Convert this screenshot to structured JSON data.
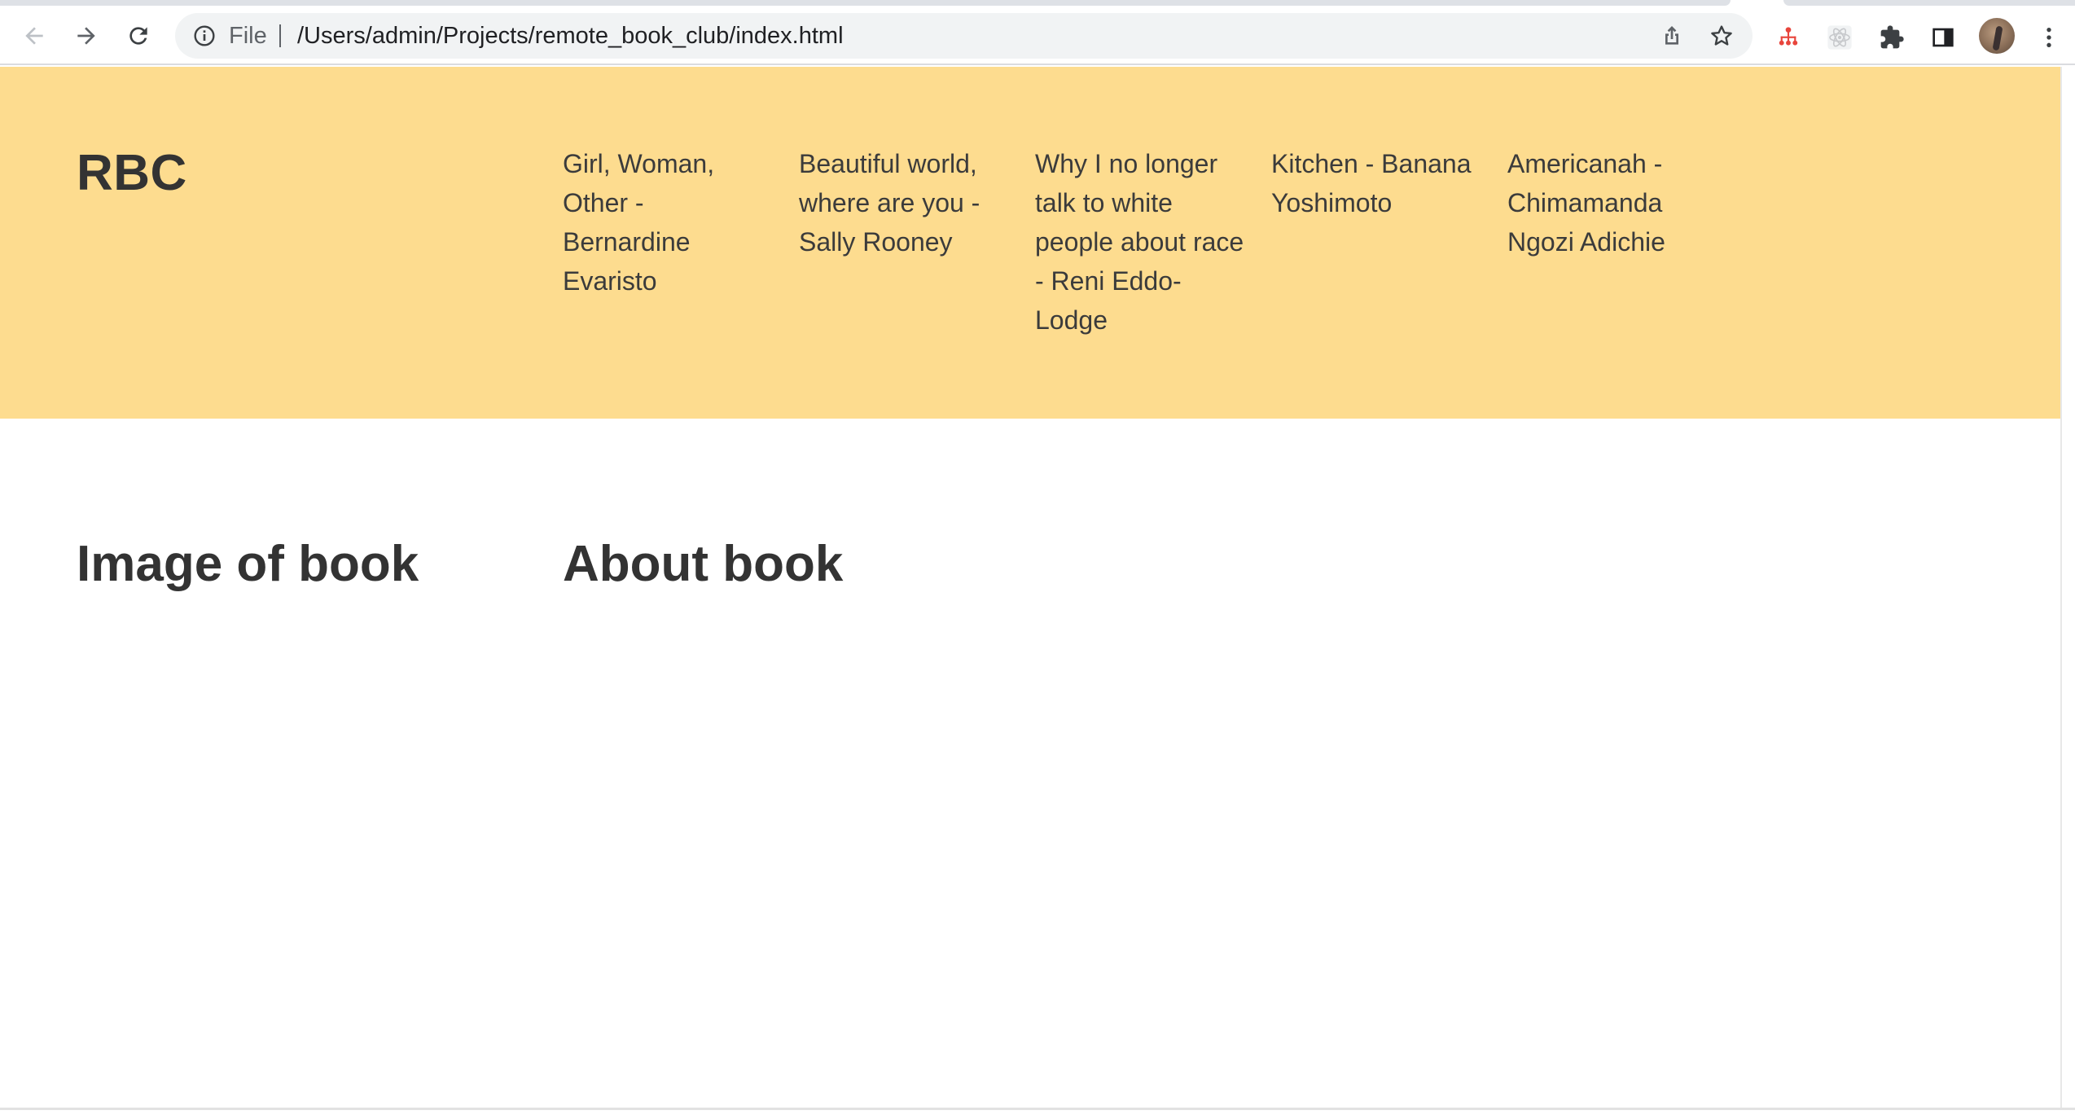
{
  "browser": {
    "scheme_label": "File",
    "url": "/Users/admin/Projects/remote_book_club/index.html",
    "icons": {
      "back": "back-arrow-icon",
      "forward": "forward-arrow-icon",
      "reload": "reload-icon",
      "site_info": "info-icon",
      "share": "share-icon",
      "bookmark": "star-icon",
      "extension_1": "extension-tree-icon",
      "extension_2": "extension-react-icon",
      "extensions": "puzzle-piece-icon",
      "side_panel": "side-panel-icon",
      "profile": "avatar",
      "menu": "kebab-menu-icon"
    }
  },
  "page": {
    "brand": "RBC",
    "nav": [
      {
        "label": "Girl, Woman, Other - Bernardine Evaristo"
      },
      {
        "label": "Beautiful world, where are you - Sally Rooney"
      },
      {
        "label": "Why I no longer talk to white people about race - Reni Eddo-Lodge"
      },
      {
        "label": "Kitchen - Banana Yoshimoto"
      },
      {
        "label": "Americanah - Chimamanda Ngozi Adichie"
      }
    ],
    "sections": {
      "image_heading": "Image of book",
      "about_heading": "About book"
    }
  },
  "colors": {
    "header_background": "#fddc8f",
    "text": "#333333",
    "page_background": "#ffffff",
    "toolbar_background": "#ffffff",
    "omnibox_background": "#f1f3f4"
  }
}
